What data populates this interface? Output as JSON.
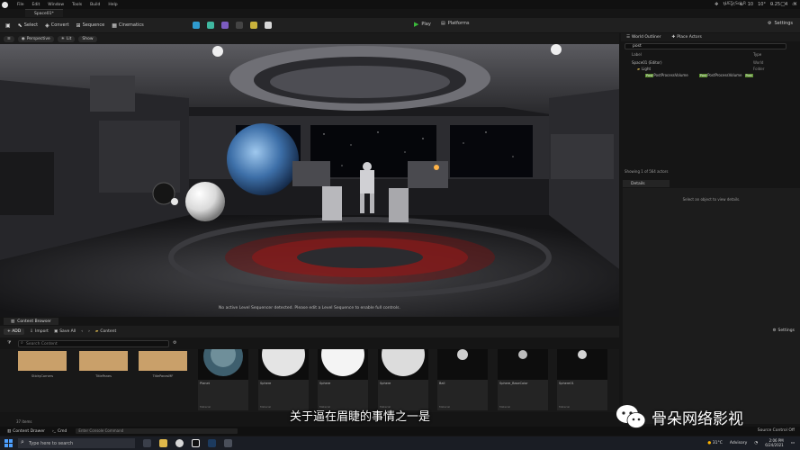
{
  "menu": {
    "items": [
      "File",
      "Edit",
      "Window",
      "Tools",
      "Build",
      "Help"
    ],
    "project": "UE5_Sci_R"
  },
  "level_tab": "Space01*",
  "toolbar": {
    "items": [
      {
        "label": "Select",
        "icon": "cursor-icon"
      },
      {
        "label": "Convert",
        "icon": "convert-icon"
      },
      {
        "label": "Sequence",
        "icon": "sequence-icon"
      },
      {
        "label": "Cinematics",
        "icon": "cinematics-icon"
      }
    ],
    "play": "Play",
    "platforms": "Platforms",
    "settings": "Settings"
  },
  "viewport": {
    "perspective": "Perspective",
    "lit": "Lit",
    "show": "Show",
    "snap_value": "10",
    "angle_value": "10°",
    "scale_value": "0.25",
    "camera_speed": "4",
    "message": "No active Level Sequencer detected. Please edit a Level Sequence to enable full controls."
  },
  "outliner": {
    "tabs": [
      "World Outliner",
      "Place Actors"
    ],
    "search_value": "post",
    "col_label": "Label",
    "col_type": "Type",
    "rows": [
      {
        "label": "Space01 (Editor)",
        "type": "World"
      },
      {
        "label": "Light",
        "type": "Folder"
      },
      {
        "label": "PostProcessVolume",
        "tag1": "Post",
        "mid": "PostProcessVolume",
        "tag2": "Post"
      }
    ],
    "footer": "Showing 1 of 564 actors"
  },
  "details": {
    "tab": "Details",
    "message": "Select an object to view details."
  },
  "content_browser": {
    "tab": "Content Browser",
    "add": "+ ADD",
    "import": "Import",
    "save_all": "Save All",
    "folder": "Content",
    "settings": "Settings",
    "search_placeholder": "Search Content",
    "color_tiles": [
      "StickyCorners",
      "TitlePanes",
      "TitlePanesMF"
    ],
    "sphere_tiles": [
      {
        "label": "Planet",
        "sub": "Material"
      },
      {
        "label": "Sphere",
        "sub": "Material"
      },
      {
        "label": "Sphere",
        "sub": "Material"
      },
      {
        "label": "Sphere",
        "sub": "Material"
      },
      {
        "label": "Ball",
        "sub": "Material"
      },
      {
        "label": "Sphere_BaseColor",
        "sub": "Material"
      },
      {
        "label": "Sphere01",
        "sub": "Material"
      }
    ],
    "count": "37 items"
  },
  "statusbar": {
    "content_drawer": "Content Drawer",
    "cmd": "Cmd",
    "cmd_placeholder": "Enter Console Command",
    "right": "Source Control Off"
  },
  "taskbar": {
    "search_placeholder": "Type here to search",
    "weather": "31°C",
    "tray": "Advisory",
    "time": "2:06 PM",
    "date": "6/24/2021"
  },
  "subtitle": "关于逼在眉睫的事情之一是",
  "watermark": "骨朵网络影视"
}
